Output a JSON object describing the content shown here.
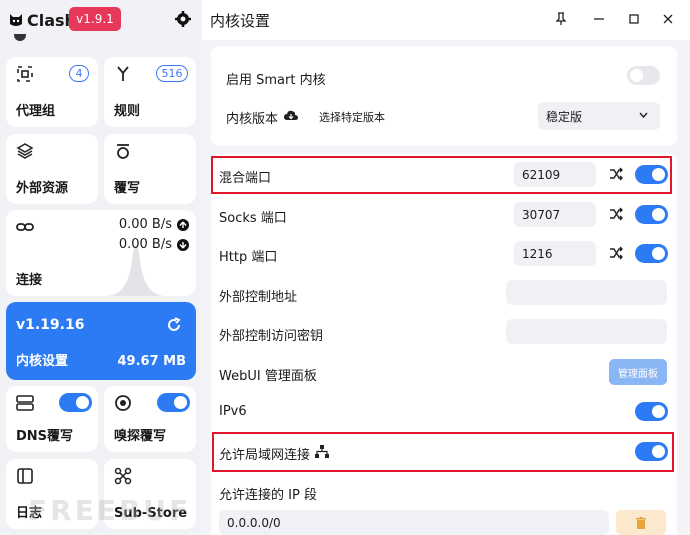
{
  "app": {
    "name": "Clash",
    "version": "v1.9.1"
  },
  "sidebar": {
    "proxy_group": {
      "label": "代理组",
      "count": "4"
    },
    "rules": {
      "label": "规则",
      "count": "516"
    },
    "external_resources": {
      "label": "外部资源"
    },
    "override": {
      "label": "覆写"
    },
    "connections": {
      "label": "连接",
      "upload": "0.00 B/s",
      "download": "0.00 B/s"
    },
    "core": {
      "version": "v1.19.16",
      "label": "内核设置",
      "memory": "49.67 MB"
    },
    "dns": {
      "label": "DNS覆写"
    },
    "sniff": {
      "label": "嗅探覆写"
    },
    "logs": {
      "label": "日志"
    },
    "substore": {
      "label": "Sub-Store"
    }
  },
  "main": {
    "title": "内核设置",
    "smart_core_label": "启用 Smart 内核",
    "core_version_label": "内核版本",
    "select_version_label": "选择特定版本",
    "core_version_value": "稳定版",
    "mixed_port": {
      "label": "混合端口",
      "value": "62109"
    },
    "socks_port": {
      "label": "Socks 端口",
      "value": "30707"
    },
    "http_port": {
      "label": "Http 端口",
      "value": "1216"
    },
    "ext_controller_label": "外部控制地址",
    "ext_secret_label": "外部控制访问密钥",
    "webui_label": "WebUI 管理面板",
    "webui_button": "管理面板",
    "ipv6_label": "IPv6",
    "allow_lan_label": "允许局域网连接",
    "allowed_ip_label": "允许连接的 IP 段",
    "allowed_ip_value": "0.0.0.0/0"
  },
  "watermark": "FREEBUF",
  "colors": {
    "accent": "#2d7bf4",
    "badge": "#e8385a",
    "highlight": "#e0162b"
  }
}
